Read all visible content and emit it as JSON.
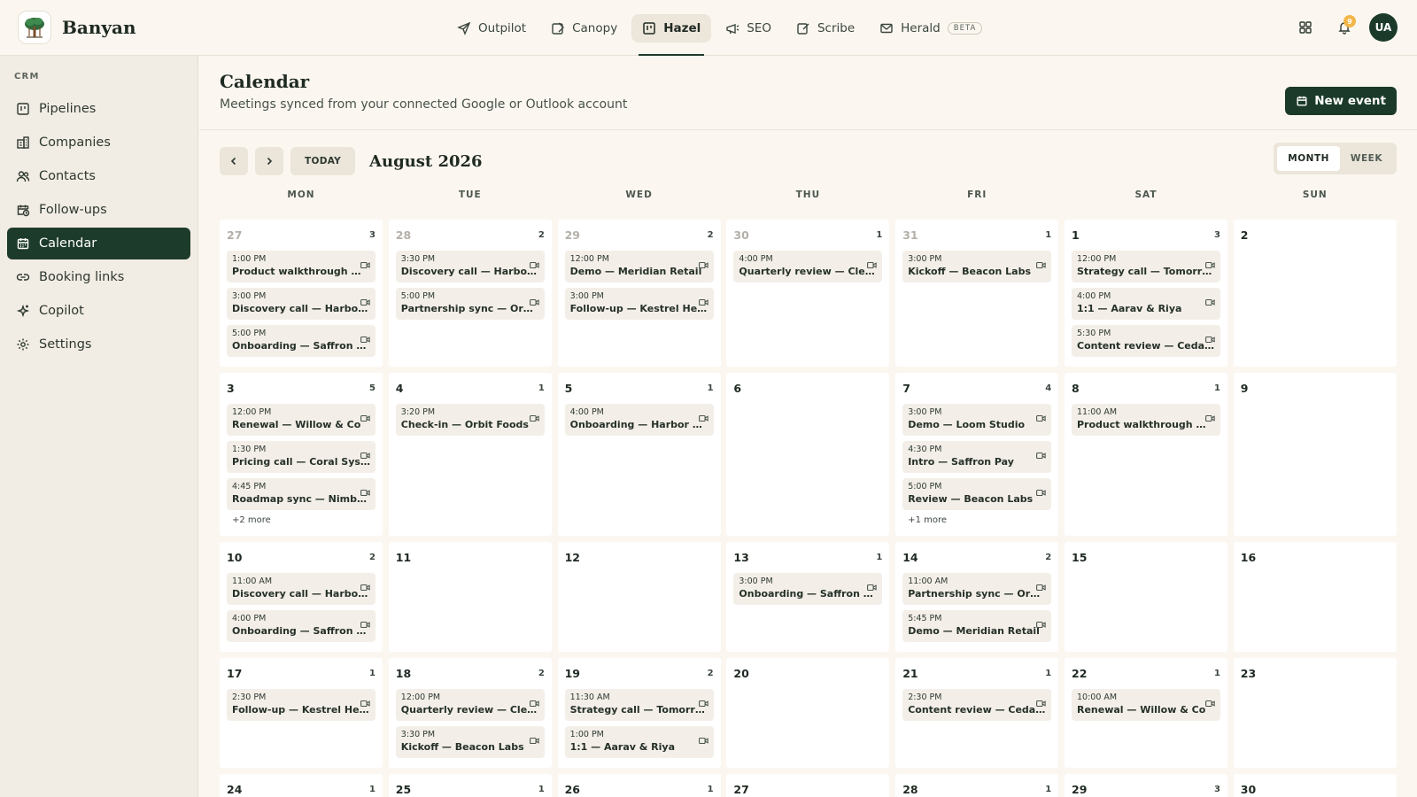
{
  "app": {
    "name": "Banyan",
    "notification_count": "9",
    "avatar_initials": "UA"
  },
  "nav": {
    "tabs": [
      {
        "label": "Outpilot",
        "icon": "send-icon",
        "active": false
      },
      {
        "label": "Canopy",
        "icon": "edit-icon",
        "active": false
      },
      {
        "label": "Hazel",
        "icon": "board-icon",
        "active": true
      },
      {
        "label": "SEO",
        "icon": "megaphone-icon",
        "active": false
      },
      {
        "label": "Scribe",
        "icon": "pen-icon",
        "active": false
      },
      {
        "label": "Herald",
        "icon": "mail-icon",
        "active": false,
        "badge": "BETA"
      }
    ]
  },
  "sidebar": {
    "section": "CRM",
    "items": [
      {
        "label": "Pipelines",
        "icon": "pipeline-icon",
        "active": false
      },
      {
        "label": "Companies",
        "icon": "building-icon",
        "active": false
      },
      {
        "label": "Contacts",
        "icon": "users-icon",
        "active": false
      },
      {
        "label": "Follow-ups",
        "icon": "calendar-clock-icon",
        "active": false
      },
      {
        "label": "Calendar",
        "icon": "calendar-icon",
        "active": true
      },
      {
        "label": "Booking links",
        "icon": "link-icon",
        "active": false
      },
      {
        "label": "Copilot",
        "icon": "sparkle-icon",
        "active": false
      },
      {
        "label": "Settings",
        "icon": "gear-icon",
        "active": false
      }
    ]
  },
  "page": {
    "title": "Calendar",
    "subtitle": "Meetings synced from your connected Google or Outlook account",
    "new_event_label": "New event"
  },
  "toolbar": {
    "today_label": "TODAY",
    "month_label": "August 2026"
  },
  "view_toggle": {
    "options": [
      "MONTH",
      "WEEK"
    ],
    "active": "MONTH"
  },
  "weekdays": [
    "MON",
    "TUE",
    "WED",
    "THU",
    "FRI",
    "SAT",
    "SUN"
  ],
  "weeks": [
    {
      "days": [
        {
          "day": "27",
          "muted": true,
          "count": "3",
          "events": [
            {
              "time": "1:00 PM",
              "title": "Product walkthrough — Nimbus Labs"
            },
            {
              "time": "3:00 PM",
              "title": "Discovery call — Harbor & Co"
            },
            {
              "time": "5:00 PM",
              "title": "Onboarding — Saffron Pay"
            }
          ]
        },
        {
          "day": "28",
          "muted": true,
          "count": "2",
          "events": [
            {
              "time": "3:30 PM",
              "title": "Discovery call — Harbor & Co"
            },
            {
              "time": "5:00 PM",
              "title": "Partnership sync — Orbit Foods"
            }
          ]
        },
        {
          "day": "29",
          "muted": true,
          "count": "2",
          "events": [
            {
              "time": "12:00 PM",
              "title": "Demo — Meridian Retail"
            },
            {
              "time": "3:00 PM",
              "title": "Follow-up — Kestrel Health"
            }
          ]
        },
        {
          "day": "30",
          "muted": true,
          "count": "1",
          "events": [
            {
              "time": "4:00 PM",
              "title": "Quarterly review — Clearwater"
            }
          ]
        },
        {
          "day": "31",
          "muted": true,
          "count": "1",
          "events": [
            {
              "time": "3:00 PM",
              "title": "Kickoff — Beacon Labs"
            }
          ]
        },
        {
          "day": "1",
          "muted": false,
          "count": "3",
          "events": [
            {
              "time": "12:00 PM",
              "title": "Strategy call — Tomorrow Foods"
            },
            {
              "time": "4:00 PM",
              "title": "1:1 — Aarav & Riya"
            },
            {
              "time": "5:30 PM",
              "title": "Content review — Cedar Labs"
            }
          ]
        },
        {
          "day": "2",
          "muted": false,
          "count": "",
          "events": []
        }
      ]
    },
    {
      "days": [
        {
          "day": "3",
          "muted": false,
          "count": "5",
          "events": [
            {
              "time": "12:00 PM",
              "title": "Renewal — Willow & Co"
            },
            {
              "time": "1:30 PM",
              "title": "Pricing call — Coral Systems"
            },
            {
              "time": "4:45 PM",
              "title": "Roadmap sync — Nimbus Labs"
            }
          ],
          "more": "+2 more"
        },
        {
          "day": "4",
          "muted": false,
          "count": "1",
          "events": [
            {
              "time": "3:20 PM",
              "title": "Check-in — Orbit Foods"
            }
          ]
        },
        {
          "day": "5",
          "muted": false,
          "count": "1",
          "events": [
            {
              "time": "4:00 PM",
              "title": "Onboarding — Harbor & Co"
            }
          ]
        },
        {
          "day": "6",
          "muted": false,
          "count": "",
          "events": []
        },
        {
          "day": "7",
          "muted": false,
          "count": "4",
          "events": [
            {
              "time": "3:00 PM",
              "title": "Demo — Loom Studio"
            },
            {
              "time": "4:30 PM",
              "title": "Intro — Saffron Pay"
            },
            {
              "time": "5:00 PM",
              "title": "Review — Beacon Labs"
            }
          ],
          "more": "+1 more"
        },
        {
          "day": "8",
          "muted": false,
          "count": "1",
          "events": [
            {
              "time": "11:00 AM",
              "title": "Product walkthrough — Nimbus Labs"
            }
          ]
        },
        {
          "day": "9",
          "muted": false,
          "count": "",
          "events": []
        }
      ]
    },
    {
      "days": [
        {
          "day": "10",
          "muted": false,
          "count": "2",
          "events": [
            {
              "time": "11:00 AM",
              "title": "Discovery call — Harbor & Co"
            },
            {
              "time": "4:00 PM",
              "title": "Onboarding — Saffron Pay"
            }
          ]
        },
        {
          "day": "11",
          "muted": false,
          "count": "",
          "events": []
        },
        {
          "day": "12",
          "muted": false,
          "count": "",
          "events": []
        },
        {
          "day": "13",
          "muted": false,
          "count": "1",
          "events": [
            {
              "time": "3:00 PM",
              "title": "Onboarding — Saffron Pay"
            }
          ]
        },
        {
          "day": "14",
          "muted": false,
          "count": "2",
          "events": [
            {
              "time": "11:00 AM",
              "title": "Partnership sync — Orbit Foods"
            },
            {
              "time": "5:45 PM",
              "title": "Demo — Meridian Retail"
            }
          ]
        },
        {
          "day": "15",
          "muted": false,
          "count": "",
          "events": []
        },
        {
          "day": "16",
          "muted": false,
          "count": "",
          "events": []
        }
      ]
    },
    {
      "days": [
        {
          "day": "17",
          "muted": false,
          "count": "1",
          "events": [
            {
              "time": "2:30 PM",
              "title": "Follow-up — Kestrel Health"
            }
          ]
        },
        {
          "day": "18",
          "muted": false,
          "count": "2",
          "events": [
            {
              "time": "12:00 PM",
              "title": "Quarterly review — Clearwater"
            },
            {
              "time": "3:30 PM",
              "title": "Kickoff — Beacon Labs"
            }
          ]
        },
        {
          "day": "19",
          "muted": false,
          "count": "2",
          "events": [
            {
              "time": "11:30 AM",
              "title": "Strategy call — Tomorrow Foods"
            },
            {
              "time": "1:00 PM",
              "title": "1:1 — Aarav & Riya"
            }
          ]
        },
        {
          "day": "20",
          "muted": false,
          "count": "",
          "events": []
        },
        {
          "day": "21",
          "muted": false,
          "count": "1",
          "events": [
            {
              "time": "2:30 PM",
              "title": "Content review — Cedar Labs"
            }
          ]
        },
        {
          "day": "22",
          "muted": false,
          "count": "1",
          "events": [
            {
              "time": "10:00 AM",
              "title": "Renewal — Willow & Co"
            }
          ]
        },
        {
          "day": "23",
          "muted": false,
          "count": "",
          "events": []
        }
      ]
    },
    {
      "days": [
        {
          "day": "24",
          "muted": false,
          "count": "1",
          "events": []
        },
        {
          "day": "25",
          "muted": false,
          "count": "1",
          "events": []
        },
        {
          "day": "26",
          "muted": false,
          "count": "1",
          "events": []
        },
        {
          "day": "27",
          "muted": false,
          "count": "",
          "events": []
        },
        {
          "day": "28",
          "muted": false,
          "count": "1",
          "events": []
        },
        {
          "day": "29",
          "muted": false,
          "count": "3",
          "events": []
        },
        {
          "day": "30",
          "muted": false,
          "count": "",
          "events": []
        }
      ]
    }
  ]
}
